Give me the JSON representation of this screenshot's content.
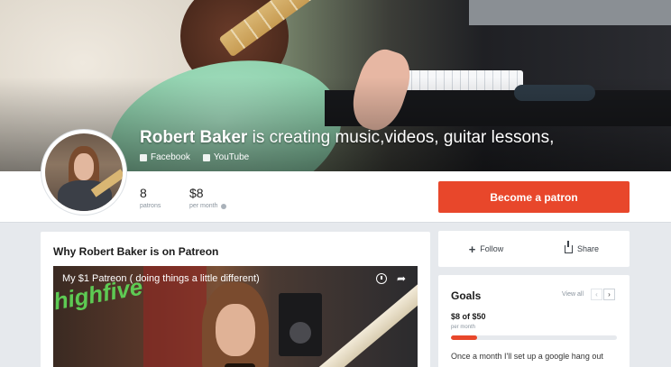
{
  "creator": {
    "name": "Robert Baker",
    "tagline": "is creating music,videos, guitar lessons,"
  },
  "social": [
    {
      "label": "Facebook",
      "icon": "facebook-icon"
    },
    {
      "label": "YouTube",
      "icon": "youtube-icon"
    }
  ],
  "stats": {
    "patrons_count": "8",
    "patrons_label": "patrons",
    "amount": "$8",
    "amount_label": "per month"
  },
  "cta": {
    "become_label": "Become a patron"
  },
  "about": {
    "heading": "Why Robert Baker is on Patreon",
    "video_title": "My $1 Patreon ( doing things a little different)",
    "video_overlay": "highfive"
  },
  "actions": {
    "follow_label": "Follow",
    "share_label": "Share"
  },
  "goals": {
    "heading": "Goals",
    "view_all": "View all",
    "prev_glyph": "‹",
    "next_glyph": "›",
    "amount": "$8 of $50",
    "per": "per month",
    "progress_fraction": 0.16,
    "description": "Once a month I'll set up a google hang out"
  },
  "colors": {
    "accent": "#e8472b",
    "cover_text": "#ffffff"
  }
}
